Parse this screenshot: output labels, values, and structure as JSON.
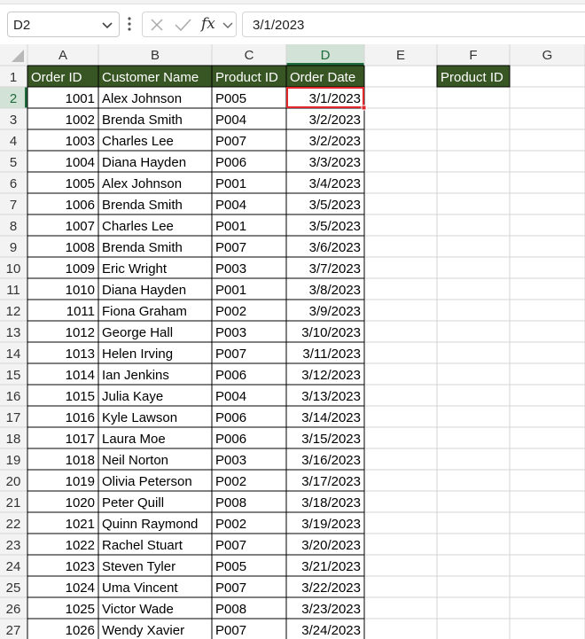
{
  "formula_bar": {
    "name_box": "D2",
    "fx_label": "fx",
    "formula": "3/1/2023"
  },
  "grid": {
    "columns": [
      "A",
      "B",
      "C",
      "D",
      "E",
      "F",
      "G"
    ],
    "selected_column": "D",
    "selected_row": 2,
    "header_row": [
      "Order ID",
      "Customer Name",
      "Product ID",
      "Order Date"
    ],
    "f1_header": "Product ID",
    "rows": [
      {
        "row": 2,
        "order_id": "1001",
        "customer": "Alex Johnson",
        "product": "P005",
        "date": "3/1/2023"
      },
      {
        "row": 3,
        "order_id": "1002",
        "customer": "Brenda Smith",
        "product": "P004",
        "date": "3/2/2023"
      },
      {
        "row": 4,
        "order_id": "1003",
        "customer": "Charles Lee",
        "product": "P007",
        "date": "3/2/2023"
      },
      {
        "row": 5,
        "order_id": "1004",
        "customer": "Diana Hayden",
        "product": "P006",
        "date": "3/3/2023"
      },
      {
        "row": 6,
        "order_id": "1005",
        "customer": "Alex Johnson",
        "product": "P001",
        "date": "3/4/2023"
      },
      {
        "row": 7,
        "order_id": "1006",
        "customer": "Brenda Smith",
        "product": "P004",
        "date": "3/5/2023"
      },
      {
        "row": 8,
        "order_id": "1007",
        "customer": "Charles Lee",
        "product": "P001",
        "date": "3/5/2023"
      },
      {
        "row": 9,
        "order_id": "1008",
        "customer": "Brenda Smith",
        "product": "P007",
        "date": "3/6/2023"
      },
      {
        "row": 10,
        "order_id": "1009",
        "customer": "Eric Wright",
        "product": "P003",
        "date": "3/7/2023"
      },
      {
        "row": 11,
        "order_id": "1010",
        "customer": "Diana Hayden",
        "product": "P001",
        "date": "3/8/2023"
      },
      {
        "row": 12,
        "order_id": "1011",
        "customer": "Fiona Graham",
        "product": "P002",
        "date": "3/9/2023"
      },
      {
        "row": 13,
        "order_id": "1012",
        "customer": "George Hall",
        "product": "P003",
        "date": "3/10/2023"
      },
      {
        "row": 14,
        "order_id": "1013",
        "customer": "Helen Irving",
        "product": "P007",
        "date": "3/11/2023"
      },
      {
        "row": 15,
        "order_id": "1014",
        "customer": "Ian Jenkins",
        "product": "P006",
        "date": "3/12/2023"
      },
      {
        "row": 16,
        "order_id": "1015",
        "customer": "Julia Kaye",
        "product": "P004",
        "date": "3/13/2023"
      },
      {
        "row": 17,
        "order_id": "1016",
        "customer": "Kyle Lawson",
        "product": "P006",
        "date": "3/14/2023"
      },
      {
        "row": 18,
        "order_id": "1017",
        "customer": "Laura Moe",
        "product": "P006",
        "date": "3/15/2023"
      },
      {
        "row": 19,
        "order_id": "1018",
        "customer": "Neil Norton",
        "product": "P003",
        "date": "3/16/2023"
      },
      {
        "row": 20,
        "order_id": "1019",
        "customer": "Olivia Peterson",
        "product": "P002",
        "date": "3/17/2023"
      },
      {
        "row": 21,
        "order_id": "1020",
        "customer": "Peter Quill",
        "product": "P008",
        "date": "3/18/2023"
      },
      {
        "row": 22,
        "order_id": "1021",
        "customer": "Quinn Raymond",
        "product": "P002",
        "date": "3/19/2023"
      },
      {
        "row": 23,
        "order_id": "1022",
        "customer": "Rachel Stuart",
        "product": "P007",
        "date": "3/20/2023"
      },
      {
        "row": 24,
        "order_id": "1023",
        "customer": "Steven Tyler",
        "product": "P005",
        "date": "3/21/2023"
      },
      {
        "row": 25,
        "order_id": "1024",
        "customer": "Uma Vincent",
        "product": "P007",
        "date": "3/22/2023"
      },
      {
        "row": 26,
        "order_id": "1025",
        "customer": "Victor Wade",
        "product": "P008",
        "date": "3/23/2023"
      },
      {
        "row": 27,
        "order_id": "1026",
        "customer": "Wendy Xavier",
        "product": "P007",
        "date": "3/24/2023"
      }
    ]
  },
  "colors": {
    "header_fill": "#375623",
    "header_text": "#ffffff",
    "selection_outline": "#e0262b",
    "selected_col_header": "#d3e2d6",
    "selected_col_header_text": "#1e6b3c",
    "grid_line": "#d4d4d4",
    "cell_border": "#000000"
  }
}
